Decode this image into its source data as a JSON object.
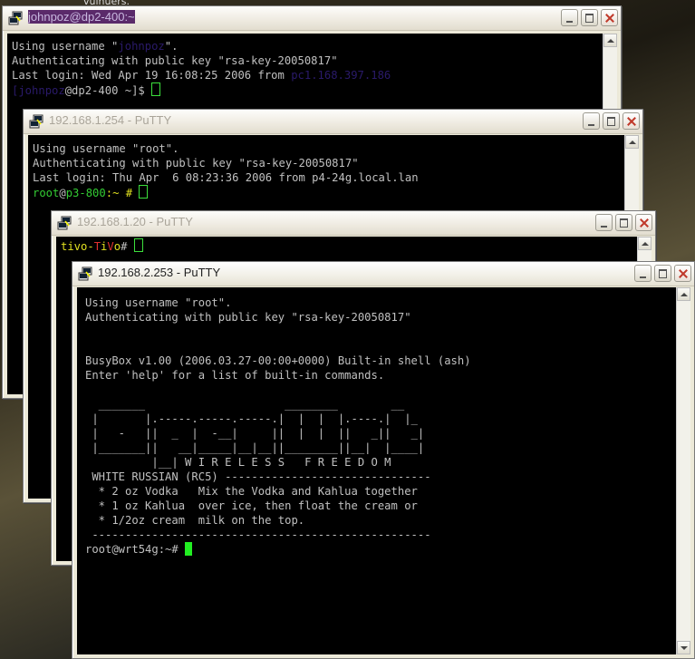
{
  "desktop": {
    "top_text": "vulnuers."
  },
  "windows": [
    {
      "title": "johnpoz@dp2-400:~",
      "lines": [
        {
          "a": "Using username \"",
          "b": "johnpoz",
          "c": "\"."
        },
        {
          "text": "Authenticating with public key \"rsa-key-20050817\""
        },
        {
          "a": "Last login: Wed Apr 19 16:08:25 2006 from ",
          "b": "pc1.168.397.186"
        },
        {
          "a": "[",
          "b": "johnpoz",
          "c": "@dp2-400 ~]$ "
        }
      ]
    },
    {
      "title": "192.168.1.254 - PuTTY",
      "lines": [
        {
          "text": "Using username \"root\"."
        },
        {
          "text": "Authenticating with public key \"rsa-key-20050817\""
        },
        {
          "text": "Last login: Thu Apr  6 08:23:36 2006 from p4-24g.local.lan"
        },
        {
          "user": "root",
          "at": "@",
          "host": "p3-800",
          "path": ":~ # "
        }
      ]
    },
    {
      "title": "192.168.1.20 - PuTTY",
      "lines": [
        {
          "p1": "tivo-",
          "p2": "T",
          "p3": "i",
          "p4": "V",
          "p5": "o",
          "p6": "# "
        }
      ]
    },
    {
      "title": "192.168.2.253 - PuTTY",
      "lines": [
        "Using username \"root\".",
        "Authenticating with public key \"rsa-key-20050817\"",
        "",
        "",
        "BusyBox v1.00 (2006.03.27-00:00+0000) Built-in shell (ash)",
        "Enter 'help' for a list of built-in commands.",
        "",
        "  _______                     ________        __",
        " |       |.-----.-----.-----.|  |  |  |.----.|  |_",
        " |   -   ||  _  |  -__|     ||  |  |  ||   _||   _|",
        " |_______||   __|_____|__|__||________||__|  |____|",
        "          |__| W I R E L E S S   F R E E D O M",
        " WHITE RUSSIAN (RC5) -------------------------------",
        "  * 2 oz Vodka   Mix the Vodka and Kahlua together",
        "  * 1 oz Kahlua  over ice, then float the cream or",
        "  * 1/2oz cream  milk on the top.",
        " ---------------------------------------------------",
        "root@wrt54g:~# "
      ]
    }
  ]
}
